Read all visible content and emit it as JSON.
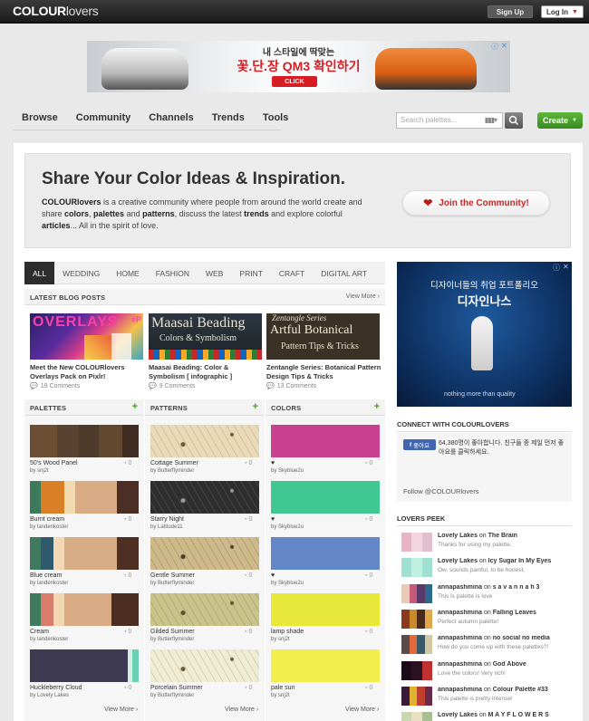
{
  "topbar": {
    "logo_bold": "COLOUR",
    "logo_rest": "lovers",
    "signup": "Sign Up",
    "login": "Log In"
  },
  "ad_top": {
    "line1": "내 스타일에 딱맞는",
    "line2": "꽃.단.장 QM3 확인하기",
    "button": "CLICK"
  },
  "nav": {
    "items": [
      "Browse",
      "Community",
      "Channels",
      "Trends",
      "Tools"
    ],
    "search_placeholder": "Search palettes...",
    "create": "Create"
  },
  "hero": {
    "title": "Share Your Color Ideas & Inspiration.",
    "p1": "COLOURlovers",
    "p2": " is a creative community where people from around the world create and share ",
    "p3": "colors",
    "p4": ", ",
    "p5": "palettes",
    "p6": " and ",
    "p7": "patterns",
    "p8": ", discuss the latest ",
    "p9": "trends",
    "p10": " and explore colorful ",
    "p11": "articles",
    "p12": "... All in the spirit of love.",
    "join": "Join the Community!"
  },
  "tabs": [
    "ALL",
    "WEDDING",
    "HOME",
    "FASHION",
    "WEB",
    "PRINT",
    "CRAFT",
    "DIGITAL ART"
  ],
  "blog": {
    "header": "LATEST BLOG POSTS",
    "view_more": "View More ›",
    "posts": [
      {
        "img_title": "OVERLAYS",
        "img_tag": "#P",
        "title": "Meet the New COLOURlovers Overlays Pack on Pixlr!",
        "comments": "19 Comments"
      },
      {
        "img_title": "Maasai Beading",
        "img_sub": "Colors & Symbolism",
        "title": "Maasai Beading: Color & Symbolism [ infographic ]",
        "comments": "9 Comments"
      },
      {
        "img_title": "Zentangle Series",
        "img_sub": "Artful Botanical",
        "img_sub2": "Pattern Tips & Tricks",
        "title": "Zentangle Series: Botanical Pattern Design Tips & Tricks",
        "comments": "13 Comments"
      }
    ]
  },
  "palettes": {
    "header": "PALETTES",
    "items": [
      {
        "name": "50's Wood Panel",
        "by": "by snj2t",
        "likes": "0",
        "colors": [
          "#6b4e34",
          "#5a4230",
          "#4e3a2a",
          "#634830",
          "#402c20"
        ],
        "widths": [
          25,
          20,
          18,
          22,
          15
        ]
      },
      {
        "name": "Burnt cream",
        "by": "by landenkoster",
        "likes": "0",
        "colors": [
          "#3d7a5c",
          "#d97f26",
          "#f3d9b0",
          "#d8ab84",
          "#4b2f24"
        ],
        "widths": [
          10,
          22,
          10,
          38,
          20
        ]
      },
      {
        "name": "Blue cream",
        "by": "by landenkoster",
        "likes": "0",
        "colors": [
          "#3f7a5e",
          "#2f5a6e",
          "#f4d7b4",
          "#d8ac84",
          "#4d2f24"
        ],
        "widths": [
          10,
          12,
          10,
          48,
          20
        ]
      },
      {
        "name": "Cream",
        "by": "by landenkoster",
        "likes": "0",
        "colors": [
          "#3e7a5d",
          "#d97c6a",
          "#f2d7b2",
          "#d9ab84",
          "#4b2d22"
        ],
        "widths": [
          10,
          12,
          10,
          43,
          25
        ]
      },
      {
        "name": "Huckleberry Cloud",
        "by": "by Lovely Lakes",
        "likes": "0",
        "colors": [
          "#3d3a52",
          "#3d3a52",
          "#d7eee3",
          "#6bcfb4"
        ],
        "widths": [
          75,
          15,
          4,
          6
        ]
      }
    ],
    "view_more": "View More ›"
  },
  "patterns": {
    "header": "PATTERNS",
    "items": [
      {
        "name": "Cottage Summer",
        "by": "by Butterflyminder",
        "likes": "0",
        "bg": "#ead9b6",
        "fg": "#6b5a3a"
      },
      {
        "name": "Starry Night",
        "by": "by Latitude11",
        "likes": "0",
        "bg": "#2e2e2e",
        "fg": "#9a9a9a"
      },
      {
        "name": "Gentle Summer",
        "by": "by Butterflyminder",
        "likes": "0",
        "bg": "#cdb98a",
        "fg": "#4a3a25"
      },
      {
        "name": "Gilded Summer",
        "by": "by Butterflyminder",
        "likes": "0",
        "bg": "#c9c28a",
        "fg": "#5a5030"
      },
      {
        "name": "Porcelain Summer",
        "by": "by Butterflyminder",
        "likes": "0",
        "bg": "#f0ecd4",
        "fg": "#6a5a3a"
      }
    ],
    "view_more": "View More ›"
  },
  "colors": {
    "header": "COLORS",
    "items": [
      {
        "name": "♥",
        "by": "by Skyblue2u",
        "likes": "0",
        "hex": "#c9418e"
      },
      {
        "name": "♥",
        "by": "by Skyblue2u",
        "likes": "0",
        "hex": "#41c892"
      },
      {
        "name": "♥",
        "by": "by Skyblue2u",
        "likes": "0",
        "hex": "#6286c6"
      },
      {
        "name": "lamp shade",
        "by": "by snj2t",
        "likes": "0",
        "hex": "#e8e83a"
      },
      {
        "name": "pale sun",
        "by": "by snj2t",
        "likes": "0",
        "hex": "#f1ee4d"
      }
    ],
    "view_more": "View More ›"
  },
  "ad_side": {
    "line1": "디자이너들의 취업 포트폴리오",
    "line2": "디자인나스",
    "tag": "nothing more than quality"
  },
  "connect": {
    "header": "CONNECT WITH COLOURLOVERS",
    "like": "좋아요",
    "text": "64,380명이 좋아합니다. 친구들 중 제일 먼저 좋아요를 클릭하세요.",
    "follow": "Follow @COLOURlovers"
  },
  "peek": {
    "header": "LOVERS PEEK",
    "items": [
      {
        "user": "Lovely Lakes",
        "on": "on",
        "target": "The Brain",
        "text": "Thanks for using my palette.",
        "colors": [
          "#e8b4c6",
          "#f4d6e0",
          "#e0c0cf"
        ]
      },
      {
        "user": "Lovely Lakes",
        "on": "on",
        "target": "Icy Sugar In My Eyes",
        "text": "Ow, sounds painful, to be honest.",
        "colors": [
          "#9fe0d2",
          "#bff0e2",
          "#9fe0d2"
        ]
      },
      {
        "user": "annapashmina",
        "on": "on",
        "target": "s a v a n n a h 3",
        "text": "This is palette is love",
        "colors": [
          "#e8c9b4",
          "#c65a7a",
          "#5a3a6a",
          "#2a6a8a"
        ]
      },
      {
        "user": "annapashmina",
        "on": "on",
        "target": "Falling Leaves",
        "text": "Perfect autumn palette!",
        "colors": [
          "#8a3a1a",
          "#c88a2a",
          "#4a2a1a",
          "#e0a84a"
        ]
      },
      {
        "user": "annapashmina",
        "on": "on",
        "target": "no social no media",
        "text": "How do you come up with these palettes?!",
        "colors": [
          "#5a4a4a",
          "#e06a3a",
          "#3a5a6a",
          "#d0c8a0"
        ]
      },
      {
        "user": "annapashmina",
        "on": "on",
        "target": "God Above",
        "text": "Love the colors! Very rich!",
        "colors": [
          "#1a0a1a",
          "#2a1020",
          "#c03030"
        ]
      },
      {
        "user": "annapashmina",
        "on": "on",
        "target": "Colour Palette #33",
        "text": "This palette is pretty intense!",
        "colors": [
          "#3a1a3a",
          "#e0b030",
          "#c04030",
          "#6a2a4a"
        ]
      },
      {
        "user": "Lovely Lakes",
        "on": "on",
        "target": "M A Y F L O W E R S",
        "text": "",
        "colors": [
          "#c8d8b0",
          "#e8e0c0",
          "#a8c090"
        ]
      }
    ]
  }
}
